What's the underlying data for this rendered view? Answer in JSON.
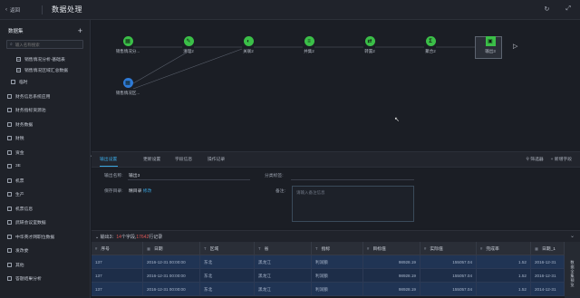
{
  "header": {
    "back_label": "返回",
    "title": "数据处理",
    "icons": [
      "refresh-icon",
      "expand-icon"
    ]
  },
  "sidebar": {
    "title": "数据集",
    "search_placeholder": "输入名称搜索",
    "items": [
      {
        "label": "销售情况分析-基础表",
        "type": "doc",
        "level": 2
      },
      {
        "label": "销售情况区域汇总数据",
        "type": "doc",
        "level": 2
      },
      {
        "label": "临时",
        "type": "folder",
        "level": 1
      },
      {
        "label": "财务信息系统应用",
        "type": "folder",
        "level": 0
      },
      {
        "label": "财务指标资源池",
        "type": "folder",
        "level": 0
      },
      {
        "label": "财务数据",
        "type": "folder",
        "level": 0
      },
      {
        "label": "财税",
        "type": "folder",
        "level": 0
      },
      {
        "label": "资金",
        "type": "folder",
        "level": 0
      },
      {
        "label": "3E",
        "type": "folder",
        "level": 0
      },
      {
        "label": "机票",
        "type": "folder",
        "level": 0
      },
      {
        "label": "生产",
        "type": "folder",
        "level": 0
      },
      {
        "label": "机票信息",
        "type": "folder",
        "level": 0
      },
      {
        "label": "武研会议室数据",
        "type": "folder",
        "level": 0
      },
      {
        "label": "中华英才网职位数据",
        "type": "folder",
        "level": 0
      },
      {
        "label": "发改委",
        "type": "folder",
        "level": 0
      },
      {
        "label": "其他",
        "type": "folder",
        "level": 0
      },
      {
        "label": "答题结果分析",
        "type": "folder",
        "level": 0
      }
    ]
  },
  "flow": {
    "nodes": [
      {
        "label": "销售情况分...",
        "symbol": "▦",
        "color": "green"
      },
      {
        "label": "清理2",
        "symbol": "✎",
        "color": "green"
      },
      {
        "label": "关联2",
        "symbol": "◐",
        "color": "green"
      },
      {
        "label": "并集2",
        "symbol": "≡",
        "color": "green"
      },
      {
        "label": "转置2",
        "symbol": "⇄",
        "color": "green"
      },
      {
        "label": "聚合2",
        "symbol": "Σ",
        "color": "green"
      },
      {
        "label": "输出3",
        "symbol": "▣",
        "color": "green"
      },
      {
        "label": "销售情况区...",
        "symbol": "▦",
        "color": "blue"
      }
    ]
  },
  "tabs": {
    "items": [
      "输出设置",
      "更新设置",
      "字段信息",
      "操作记录"
    ],
    "active": "输出设置",
    "tools": [
      "筛选器",
      "+ 新增字段"
    ]
  },
  "form": {
    "output_name_label": "输出名称:",
    "output_name_value": "输出3",
    "save_dir_label": "保存目录:",
    "save_dir_value": "精目录",
    "save_dir_link": "修改",
    "category_label": "分类标签:",
    "remark_label": "备注:",
    "remark_placeholder": "请输入备注信息"
  },
  "output": {
    "prefix": "输出3：",
    "field_count": "14",
    "field_text": "个字段,",
    "record_count": "17642",
    "record_text": "行记录"
  },
  "table": {
    "columns": [
      {
        "label": "序号",
        "type_icon": "#"
      },
      {
        "label": "日期",
        "type_icon": "▦"
      },
      {
        "label": "区域",
        "type_icon": "T"
      },
      {
        "label": "省",
        "type_icon": "T"
      },
      {
        "label": "指标",
        "type_icon": "T"
      },
      {
        "label": "目标值",
        "type_icon": "#"
      },
      {
        "label": "实际值",
        "type_icon": "#"
      },
      {
        "label": "完成率",
        "type_icon": "#"
      },
      {
        "label": "日期_1",
        "type_icon": "▦"
      }
    ],
    "rows": [
      [
        "137",
        "2016-12-31 00:00:00",
        "东北",
        "黑龙江",
        "利润额",
        "98928.19",
        "155057.04",
        "1.52",
        "2016-12-31"
      ],
      [
        "137",
        "2016-12-31 00:00:00",
        "东北",
        "黑龙江",
        "利润额",
        "98928.19",
        "155057.04",
        "1.52",
        "2016-12-31"
      ],
      [
        "137",
        "2016-12-31 00:00:00",
        "东北",
        "黑龙江",
        "利润额",
        "98928.19",
        "155057.04",
        "1.52",
        "2014-12-31"
      ]
    ],
    "side_button": "数据全集预览"
  },
  "colors": {
    "accent": "#3aa6e0",
    "node_green": "#3bbf48",
    "node_blue": "#2e7ad6",
    "highlight_red": "#e05757"
  }
}
